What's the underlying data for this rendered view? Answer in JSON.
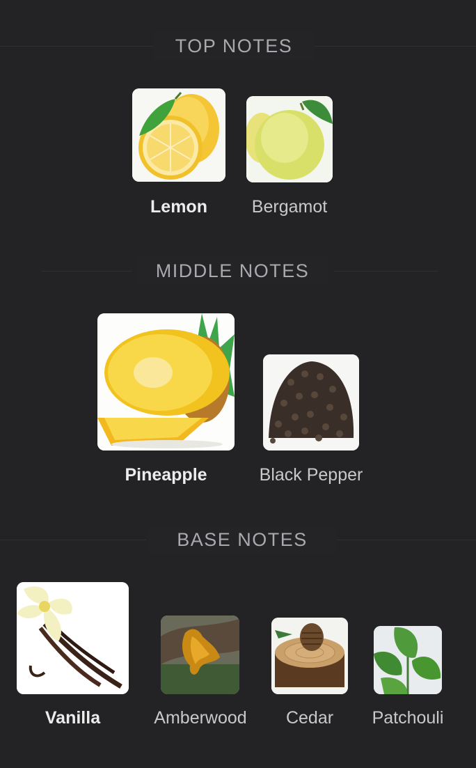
{
  "sections": [
    {
      "title": "TOP NOTES",
      "notes": [
        {
          "name": "Lemon",
          "icon": "lemon-image"
        },
        {
          "name": "Bergamot",
          "icon": "bergamot-image"
        }
      ]
    },
    {
      "title": "MIDDLE NOTES",
      "notes": [
        {
          "name": "Pineapple",
          "icon": "pineapple-image"
        },
        {
          "name": "Black Pepper",
          "icon": "black-pepper-image"
        }
      ]
    },
    {
      "title": "BASE NOTES",
      "notes": [
        {
          "name": "Vanilla",
          "icon": "vanilla-image"
        },
        {
          "name": "Amberwood",
          "icon": "amberwood-image"
        },
        {
          "name": "Cedar",
          "icon": "cedar-image"
        },
        {
          "name": "Patchouli",
          "icon": "patchouli-image"
        }
      ]
    }
  ],
  "colors": {
    "background": "#232326",
    "section_title": "#a9a9ae",
    "label": "#ececec"
  }
}
